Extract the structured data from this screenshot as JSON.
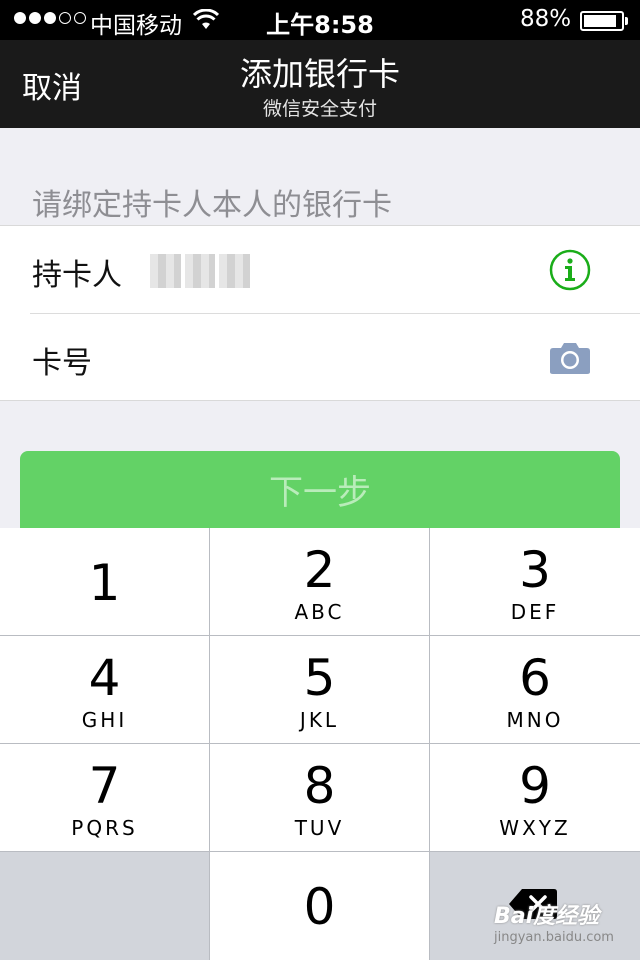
{
  "status_bar": {
    "carrier": "中国移动",
    "time": "上午8:58",
    "battery_percent": "88%",
    "battery_level": 0.88,
    "signal_bars": 3
  },
  "nav": {
    "cancel_label": "取消",
    "title": "添加银行卡",
    "subtitle": "微信安全支付"
  },
  "form": {
    "section_label": "请绑定持卡人本人的银行卡",
    "cardholder_label": "持卡人",
    "card_number_label": "卡号",
    "info_icon": "info-icon",
    "camera_icon": "camera-icon",
    "accent_color": "#1aad19"
  },
  "next_button": {
    "label": "下一步",
    "color": "#63d266"
  },
  "keypad": {
    "keys": [
      {
        "num": "1",
        "letters": ""
      },
      {
        "num": "2",
        "letters": "ABC"
      },
      {
        "num": "3",
        "letters": "DEF"
      },
      {
        "num": "4",
        "letters": "GHI"
      },
      {
        "num": "5",
        "letters": "JKL"
      },
      {
        "num": "6",
        "letters": "MNO"
      },
      {
        "num": "7",
        "letters": "PQRS"
      },
      {
        "num": "8",
        "letters": "TUV"
      },
      {
        "num": "9",
        "letters": "WXYZ"
      },
      {
        "num": "0",
        "letters": ""
      }
    ],
    "delete_icon": "backspace-icon"
  },
  "watermark": {
    "main": "Bai度经验",
    "sub": "jingyan.baidu.com"
  }
}
